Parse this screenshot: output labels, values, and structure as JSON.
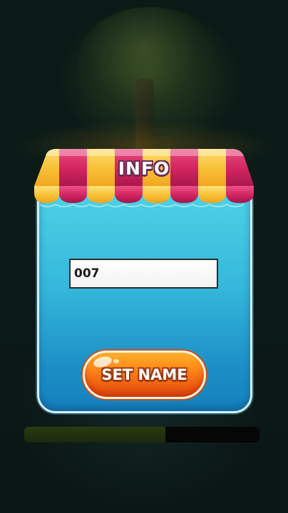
{
  "dialog": {
    "title": "INFO",
    "name_input_value": "007",
    "set_name_label": "SET NAME"
  },
  "loading": {
    "progress_fraction": 0.6
  },
  "colors": {
    "panel_top": "#4ed3e6",
    "panel_bottom": "#1581bd",
    "awning_yellow": "#f8c23a",
    "awning_magenta": "#d0245f",
    "button_orange": "#f26212"
  },
  "icons": {
    "awning": "striped-awning"
  }
}
